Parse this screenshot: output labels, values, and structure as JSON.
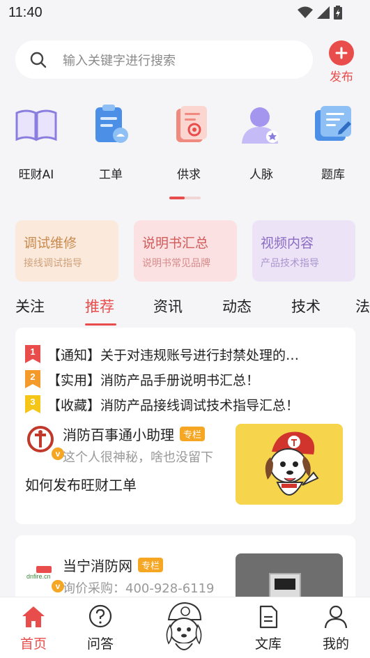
{
  "status": {
    "time": "11:40"
  },
  "search": {
    "placeholder": "输入关键字进行搜索"
  },
  "publish": {
    "label": "发布"
  },
  "categories": [
    {
      "label": "旺财AI",
      "icon": "book-icon"
    },
    {
      "label": "工单",
      "icon": "clipboard-icon"
    },
    {
      "label": "供求",
      "icon": "supply-demand-icon"
    },
    {
      "label": "人脉",
      "icon": "person-icon"
    },
    {
      "label": "题库",
      "icon": "question-bank-icon"
    }
  ],
  "quick_cards": [
    {
      "title": "调试维修",
      "subtitle": "接线调试指导",
      "color": "#c98a4d",
      "bg": "#fbe9dc"
    },
    {
      "title": "说明书汇总",
      "subtitle": "说明书常见品牌",
      "color": "#d35a5a",
      "bg": "#fbe1e1"
    },
    {
      "title": "视频内容",
      "subtitle": "产品技术指导",
      "color": "#8a6bc1",
      "bg": "#ede3f7"
    }
  ],
  "tabs": [
    "关注",
    "推荐",
    "资讯",
    "动态",
    "技术",
    "法"
  ],
  "active_tab": "推荐",
  "notices": [
    {
      "rank": "1",
      "text": "【通知】关于对违规账号进行封禁处理的…",
      "color": "#e84d4b"
    },
    {
      "rank": "2",
      "text": "【实用】消防产品手册说明书汇总！",
      "color": "#f39a2b"
    },
    {
      "rank": "3",
      "text": "【收藏】消防产品接线调试技术指导汇总！",
      "color": "#f5c518"
    }
  ],
  "post1": {
    "author": "消防百事通小助理",
    "tag": "专栏",
    "subtitle": "这个人很神秘，啥也没留下",
    "title": "如何发布旺财工单"
  },
  "post2": {
    "author": "当宁消防网",
    "tag": "专栏",
    "subtitle": "询价采购：400-928-6119",
    "logo_text": "dnfire.cn"
  },
  "bottom_nav": [
    {
      "label": "首页",
      "icon": "home-icon",
      "active": true
    },
    {
      "label": "问答",
      "icon": "question-icon",
      "active": false
    },
    {
      "label": "",
      "icon": "mascot-icon",
      "active": false
    },
    {
      "label": "文库",
      "icon": "document-icon",
      "active": false
    },
    {
      "label": "我的",
      "icon": "profile-icon",
      "active": false
    }
  ],
  "colors": {
    "accent": "#e84d4b",
    "tag": "#f5a623",
    "background": "#f5f5f7"
  }
}
